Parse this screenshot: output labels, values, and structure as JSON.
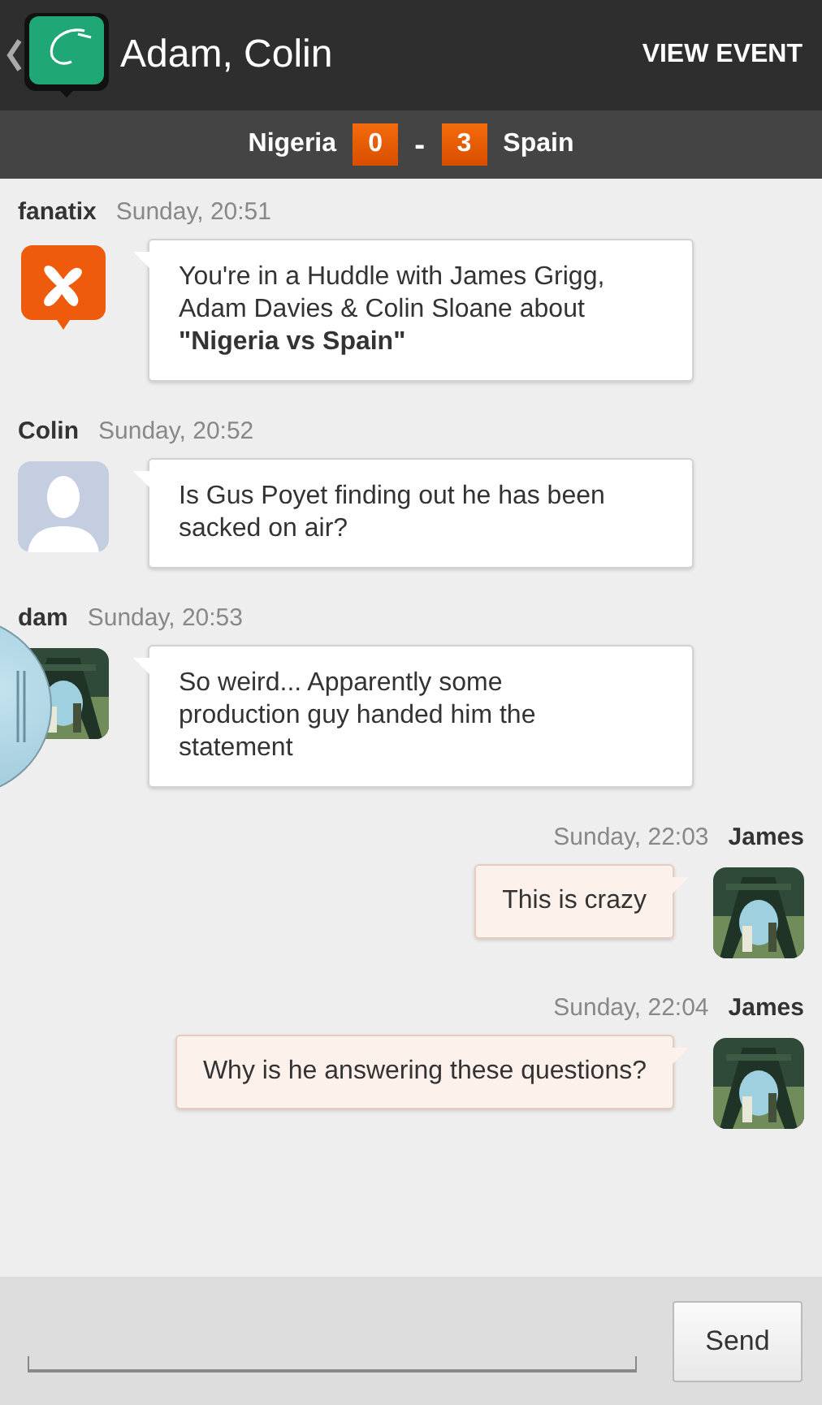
{
  "header": {
    "title": "Adam, Colin",
    "action": "VIEW EVENT"
  },
  "score": {
    "home": "Nigeria",
    "home_score": "0",
    "separator": "-",
    "away_score": "3",
    "away": "Spain"
  },
  "messages": [
    {
      "kind": "incoming",
      "sender": "fanatix",
      "time": "Sunday, 20:51",
      "avatar": {
        "kind": "logo"
      },
      "text": "You're in a Huddle with James Grigg, Adam Davies & Colin Sloane about **\"Nigeria vs Spain\"**"
    },
    {
      "kind": "incoming",
      "sender": "Colin",
      "time": "Sunday, 20:52",
      "avatar": {
        "kind": "silhouette"
      },
      "text": "Is Gus Poyet finding out he has been sacked on air?"
    },
    {
      "kind": "incoming",
      "sender": "dam",
      "time": "Sunday, 20:53",
      "text": "So weird... Apparently some production guy handed him the statement"
    },
    {
      "kind": "outgoing",
      "sender": "James",
      "time": "Sunday, 22:03",
      "text": "This is crazy"
    },
    {
      "kind": "outgoing",
      "sender": "James",
      "time": "Sunday, 22:04",
      "text": "Why is he answering these questions?"
    }
  ],
  "composer": {
    "button": "Send"
  }
}
